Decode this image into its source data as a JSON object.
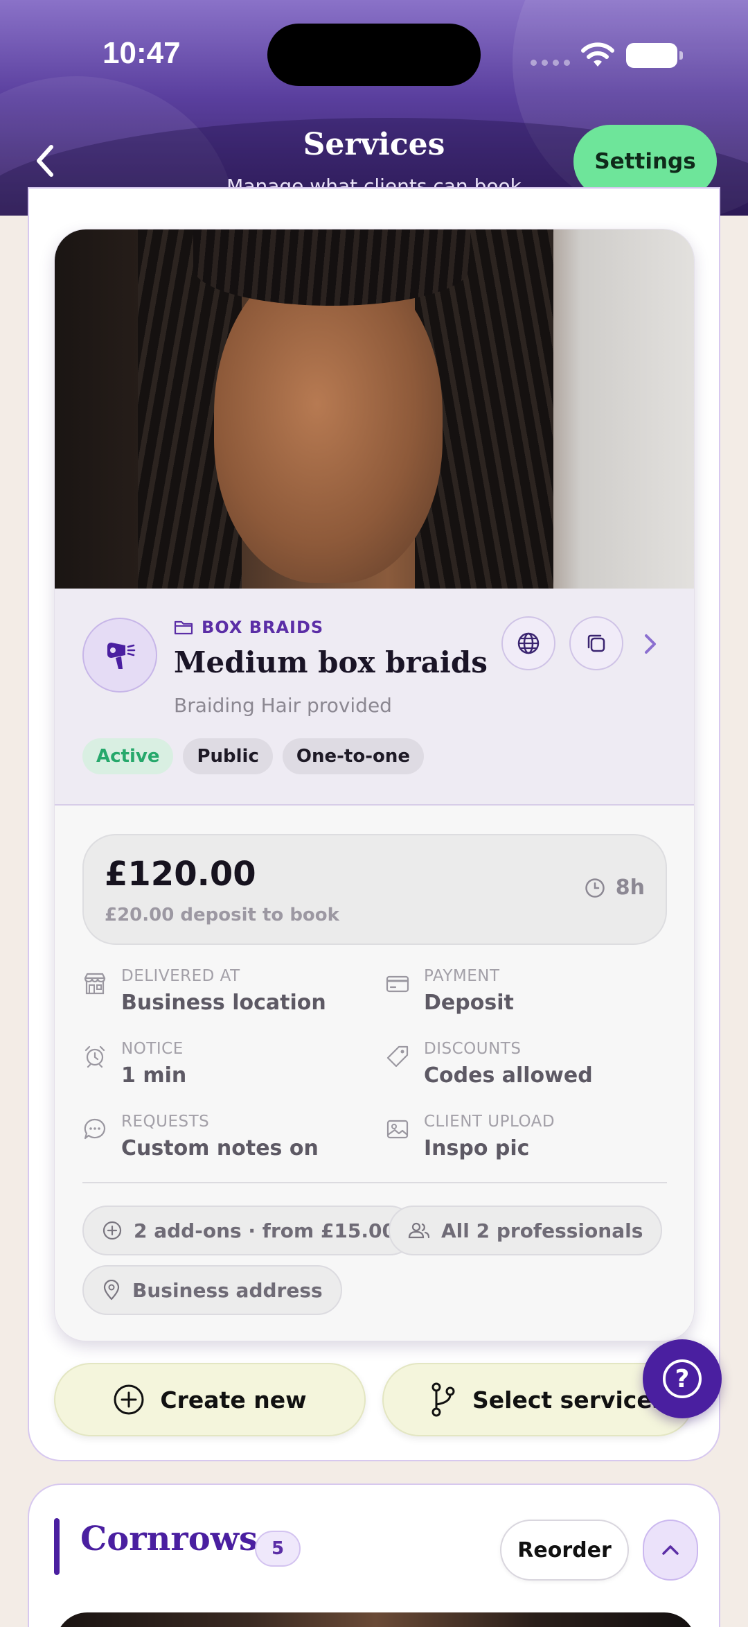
{
  "status_bar": {
    "time": "10:47"
  },
  "header": {
    "title": "Services",
    "subtitle": "Manage what clients can book",
    "settings_label": "Settings"
  },
  "service": {
    "category": "BOX BRAIDS",
    "name": "Medium box braids",
    "description": "Braiding Hair provided",
    "tags": [
      "Active",
      "Public",
      "One-to-one"
    ],
    "price": "£120.00",
    "deposit_text": "£20.00 deposit to book",
    "duration": "8h",
    "details": [
      {
        "label": "DELIVERED AT",
        "value": "Business location",
        "icon": "store-icon"
      },
      {
        "label": "PAYMENT",
        "value": "Deposit",
        "icon": "credit-card-icon"
      },
      {
        "label": "NOTICE",
        "value": "1 min",
        "icon": "alarm-clock-icon"
      },
      {
        "label": "DISCOUNTS",
        "value": "Codes allowed",
        "icon": "tag-icon"
      },
      {
        "label": "REQUESTS",
        "value": "Custom notes on",
        "icon": "chat-bubble-icon"
      },
      {
        "label": "CLIENT UPLOAD",
        "value": "Inspo pic",
        "icon": "image-icon"
      }
    ],
    "chips": {
      "addons": "2 add-ons · from £15.00",
      "professionals": "All 2 professionals",
      "address": "Business address"
    }
  },
  "actions": {
    "create_new": "Create new",
    "select_services": "Select services"
  },
  "help": {
    "glyph": "?"
  },
  "next_category": {
    "name": "Cornrows",
    "count": "5",
    "reorder_label": "Reorder"
  },
  "colors": {
    "accent": "#4a1fa0",
    "settings_green": "#6ee59a",
    "active_green": "#26a86b",
    "action_button_bg": "#f4f5dc"
  }
}
